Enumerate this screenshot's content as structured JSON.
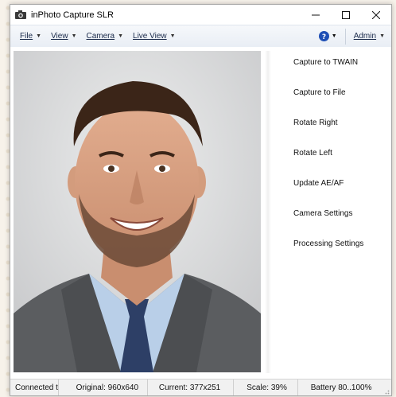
{
  "window": {
    "title": "inPhoto Capture SLR"
  },
  "menu": {
    "file": "File",
    "view": "View",
    "camera": "Camera",
    "live_view": "Live View",
    "admin": "Admin"
  },
  "actions": [
    "Capture to TWAIN",
    "Capture to File",
    "Rotate Right",
    "Rotate Left",
    "Update AE/AF",
    "Camera Settings",
    "Processing Settings"
  ],
  "status": {
    "connected": "Connected t",
    "original": "Original: 960x640",
    "current": "Current: 377x251",
    "scale": "Scale: 39%",
    "battery": "Battery 80..100%"
  },
  "colors": {
    "menu_text": "#1a2a4a",
    "help_icon": "#1f4fb5",
    "accent": "#1a2a4a"
  },
  "icons": [
    "camera-icon",
    "minimize-icon",
    "maximize-icon",
    "close-icon",
    "help-icon",
    "resize-grip-icon"
  ]
}
